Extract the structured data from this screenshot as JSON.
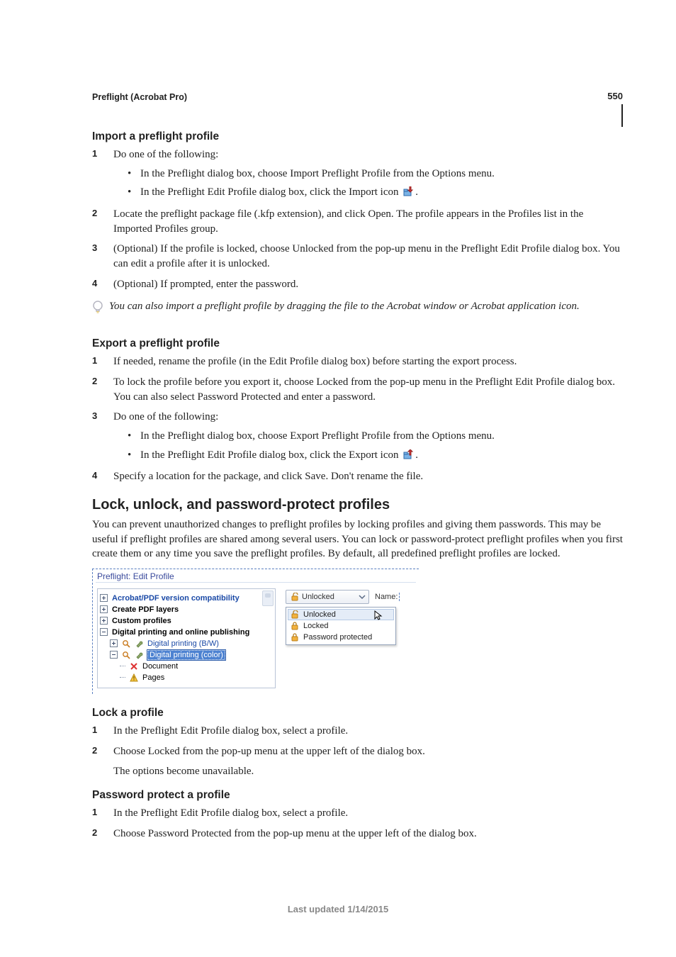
{
  "page_number": "550",
  "section_header": "Preflight (Acrobat Pro)",
  "import": {
    "heading": "Import a preflight profile",
    "step1": "Do one of the following:",
    "step1_bullets": [
      "In the Preflight dialog box, choose Import Preflight Profile from the Options menu.",
      "In the Preflight Edit Profile dialog box, click the Import icon "
    ],
    "step2": "Locate the preflight package file (.kfp extension), and click Open. The profile appears in the Profiles list in the Imported Profiles group.",
    "step3": "(Optional) If the profile is locked, choose Unlocked from the pop-up menu in the Preflight Edit Profile dialog box. You can edit a profile after it is unlocked.",
    "step4": "(Optional) If prompted, enter the password."
  },
  "tip": "You can also import a preflight profile by dragging the file to the Acrobat window or Acrobat application icon.",
  "export": {
    "heading": "Export a preflight profile",
    "step1": "If needed, rename the profile (in the Edit Profile dialog box) before starting the export process.",
    "step2": "To lock the profile before you export it, choose Locked from the pop-up menu in the Preflight Edit Profile dialog box. You can also select Password Protected and enter a password.",
    "step3": "Do one of the following:",
    "step3_bullets": [
      "In the Preflight dialog box, choose Export Preflight Profile from the Options menu.",
      "In the Preflight Edit Profile dialog box, click the Export icon "
    ],
    "step4": "Specify a location for the package, and click Save. Don't rename the file."
  },
  "lock_section": {
    "heading": "Lock, unlock, and password-protect profiles",
    "intro": "You can prevent unauthorized changes to preflight profiles by locking profiles and giving them passwords. This may be useful if preflight profiles are shared among several users. You can lock or password-protect preflight profiles when you first create them or any time you save the preflight profiles. By default, all predefined preflight profiles are locked."
  },
  "figure": {
    "title": "Preflight: Edit Profile",
    "tree": {
      "n1": "Acrobat/PDF version compatibility",
      "n2": "Create PDF layers",
      "n3": "Custom profiles",
      "n4": "Digital printing and online publishing",
      "n4a": "Digital printing (B/W)",
      "n4b": "Digital printing (color)",
      "n4b_1": "Document",
      "n4b_2": "Pages"
    },
    "dropdown_value": "Unlocked",
    "name_label": "Name:",
    "menu": {
      "i1": "Unlocked",
      "i2": "Locked",
      "i3": "Password protected"
    }
  },
  "lock_profile": {
    "heading": "Lock a profile",
    "step1": "In the Preflight Edit Profile dialog box, select a profile.",
    "step2": "Choose Locked from the pop-up menu at the upper left of the dialog box.",
    "after": "The options become unavailable."
  },
  "pw_protect": {
    "heading": "Password protect a profile",
    "step1": "In the Preflight Edit Profile dialog box, select a profile.",
    "step2": "Choose Password Protected from the pop-up menu at the upper left of the dialog box."
  },
  "footer": "Last updated 1/14/2015"
}
